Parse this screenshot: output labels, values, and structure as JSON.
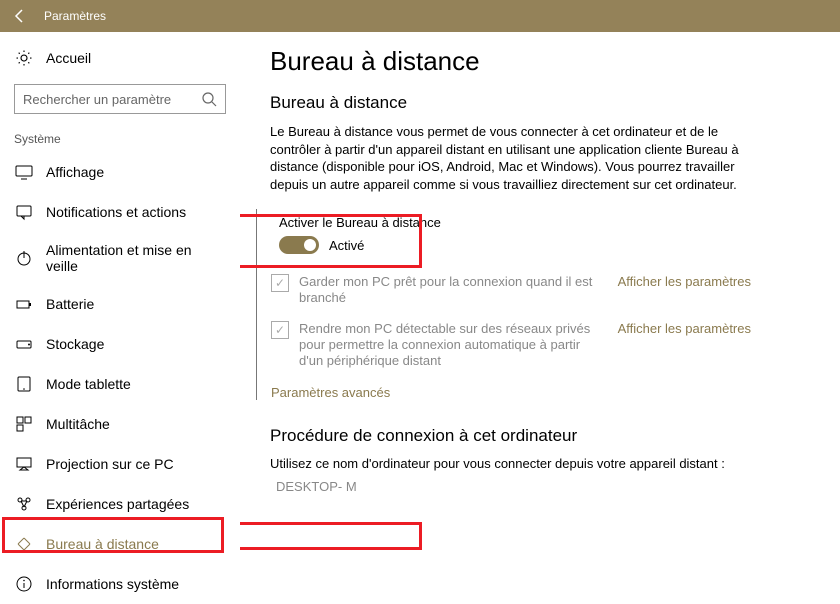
{
  "titlebar": {
    "title": "Paramètres"
  },
  "home": {
    "label": "Accueil"
  },
  "search": {
    "placeholder": "Rechercher un paramètre"
  },
  "section": "Système",
  "nav": [
    {
      "label": "Affichage"
    },
    {
      "label": "Notifications et actions"
    },
    {
      "label": "Alimentation et mise en veille"
    },
    {
      "label": "Batterie"
    },
    {
      "label": "Stockage"
    },
    {
      "label": "Mode tablette"
    },
    {
      "label": "Multitâche"
    },
    {
      "label": "Projection sur ce PC"
    },
    {
      "label": "Expériences partagées"
    },
    {
      "label": "Bureau à distance"
    },
    {
      "label": "Informations système"
    }
  ],
  "main": {
    "h1": "Bureau à distance",
    "h2": "Bureau à distance",
    "desc": "Le Bureau à distance vous permet de vous connecter à cet ordinateur et de le contrôler à partir d'un appareil distant en utilisant une application cliente Bureau à distance (disponible pour iOS, Android, Mac et Windows). Vous pourrez travailler depuis un autre appareil comme si vous travailliez directement sur cet ordinateur.",
    "toggle_label": "Activer le Bureau à distance",
    "toggle_state": "Activé",
    "opt1": "Garder mon PC prêt pour la connexion quand il est branché",
    "opt2": "Rendre mon PC détectable sur des réseaux privés pour permettre la connexion automatique à partir d'un périphérique distant",
    "show_params": "Afficher les paramètres",
    "adv": "Paramètres avancés",
    "h2b": "Procédure de connexion à cet ordinateur",
    "conn_desc": "Utilisez ce nom d'ordinateur pour vous connecter depuis votre appareil distant :",
    "pcname": "DESKTOP-           M"
  }
}
